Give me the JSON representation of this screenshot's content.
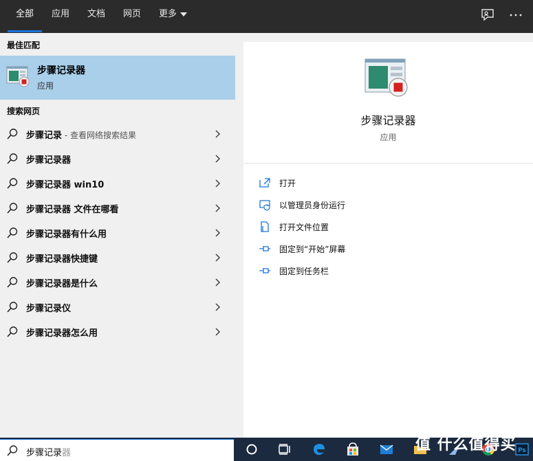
{
  "tabs": [
    "全部",
    "应用",
    "文档",
    "网页",
    "更多"
  ],
  "colors": {
    "accent": "#1a73d9",
    "selected_bg": "#a9cfea",
    "top_bg": "#2b2b2b",
    "taskbar_bg": "#1c2a3f"
  },
  "icons": {
    "feedback": "feedback-icon",
    "more": "ellipsis-icon",
    "search": "magnifier-icon",
    "chevron": "chevron-right-icon",
    "app": "steps-recorder-icon"
  },
  "left": {
    "best_match_title": "最佳匹配",
    "best_match": {
      "name": "步骤记录器",
      "type": "应用"
    },
    "web_title": "搜索网页",
    "web_results": [
      {
        "text": "步骤记录",
        "suffix": " - 查看网络搜索结果"
      },
      {
        "text": "步骤记录器",
        "suffix": ""
      },
      {
        "text": "步骤记录器 win10",
        "suffix": ""
      },
      {
        "text": "步骤记录器 文件在哪看",
        "suffix": ""
      },
      {
        "text": "步骤记录器有什么用",
        "suffix": ""
      },
      {
        "text": "步骤记录器快捷键",
        "suffix": ""
      },
      {
        "text": "步骤记录器是什么",
        "suffix": ""
      },
      {
        "text": "步骤记录仪",
        "suffix": ""
      },
      {
        "text": "步骤记录器怎么用",
        "suffix": ""
      }
    ]
  },
  "right": {
    "app_name": "步骤记录器",
    "app_type": "应用",
    "actions": [
      "打开",
      "以管理员身份运行",
      "打开文件位置",
      "固定到“开始”屏幕",
      "固定到任务栏"
    ]
  },
  "search": {
    "typed": "步骤记录",
    "ghost": "器"
  },
  "watermark": "值 什么值得买"
}
